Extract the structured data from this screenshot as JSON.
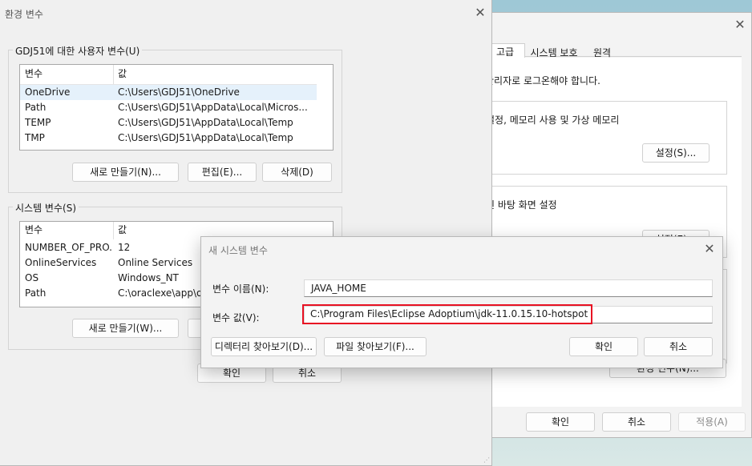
{
  "sysprops": {
    "tabs": [
      "고급",
      "시스템 보호",
      "원격"
    ],
    "admin_note": "관리자로 로그온해야 합니다.",
    "perf_text": "설정, 메모리 사용 및 가상 메모리",
    "settings_btn": "설정(S)...",
    "profile_text": "된 바탕 화면 설정",
    "settings_btn2": "설정(E)...",
    "envvars_btn": "환경 변수(N)...",
    "ok": "확인",
    "cancel": "취소",
    "apply": "적용(A)"
  },
  "envvars": {
    "title": "환경 변수",
    "user_group": "GDJ51에 대한 사용자 변수(U)",
    "col_var": "변수",
    "col_val": "값",
    "user_vars": [
      {
        "name": "OneDrive",
        "value": "C:\\Users\\GDJ51\\OneDrive"
      },
      {
        "name": "Path",
        "value": "C:\\Users\\GDJ51\\AppData\\Local\\Micros..."
      },
      {
        "name": "TEMP",
        "value": "C:\\Users\\GDJ51\\AppData\\Local\\Temp"
      },
      {
        "name": "TMP",
        "value": "C:\\Users\\GDJ51\\AppData\\Local\\Temp"
      }
    ],
    "user_new": "새로 만들기(N)...",
    "user_edit": "편집(E)...",
    "user_delete": "삭제(D)",
    "sys_group": "시스템 변수(S)",
    "sys_vars": [
      {
        "name": "NUMBER_OF_PRO...",
        "value": "12"
      },
      {
        "name": "OnlineServices",
        "value": "Online Services"
      },
      {
        "name": "OS",
        "value": "Windows_NT"
      },
      {
        "name": "Path",
        "value": "C:\\oraclexe\\app\\or"
      }
    ],
    "sys_new": "새로 만들기(W)...",
    "ok": "확인",
    "cancel": "취소"
  },
  "newvar": {
    "title": "새 시스템 변수",
    "name_label": "변수 이름(N):",
    "name_value": "JAVA_HOME",
    "value_label": "변수 값(V):",
    "value_value": "C:\\Program Files\\Eclipse Adoptium\\jdk-11.0.15.10-hotspot",
    "browse_dir": "디렉터리 찾아보기(D)...",
    "browse_file": "파일 찾아보기(F)...",
    "ok": "확인",
    "cancel": "취소"
  },
  "colors": {
    "highlight": "#e81123",
    "selected_row": "#e5f1fb"
  }
}
